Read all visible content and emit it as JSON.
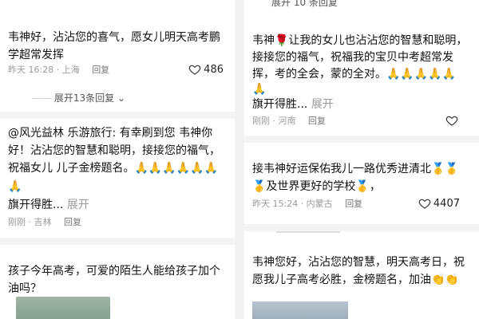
{
  "left": {
    "c1": {
      "line1": "韦神好，沾沾您的喜气，愿女儿明天高考鹏",
      "line2": "学超常发挥",
      "time": "昨天 16:28 · 上海",
      "reply": "回复",
      "likes": "486"
    },
    "expand": "展开13条回复",
    "c2": {
      "line1": "@风光益林 乐游旅行: 有幸刷到您 韦神你",
      "line2": "好！沾沾您的智慧和聪明，接接您的福气，",
      "line3": "祝福女儿 儿子金榜题名。🙏🙏🙏🙏🙏🙏",
      "line4": "🙏",
      "line5": "旗开得胜...",
      "more": "展开",
      "time": "刚刚 · 吉林",
      "reply": "回复"
    },
    "c3": {
      "line1": "孩子今年高考，可爱的陌生人能给孩子加个",
      "line2": "油吗？"
    }
  },
  "right": {
    "top": "展开 10 条回复",
    "c1": {
      "line1": "韦神🌹让我的女儿也沾沾您的智慧和聪明，",
      "line2": "接接您的福气，祝福我的宝贝中考超常发",
      "line3": "挥，考的全会，蒙的全对。🙏🙏🙏🙏🙏",
      "line4": "🙏",
      "line5": "旗开得胜...",
      "more": "展开",
      "time": "刚刚 · 河南",
      "reply": "回复"
    },
    "c2": {
      "line1": "接韦神好运保佑我儿一路优秀进清北🥇🥇",
      "line2": "🥇及世界更好的学校🥇，",
      "time": "昨天 15:24 · 内蒙古",
      "reply": "回复",
      "likes": "4407"
    },
    "c3": {
      "line1": "韦神您好，沾沾您的智慧，明天高考日，祝",
      "line2": "愿我儿子高考必胜，金榜题名，加油👏👏"
    }
  }
}
